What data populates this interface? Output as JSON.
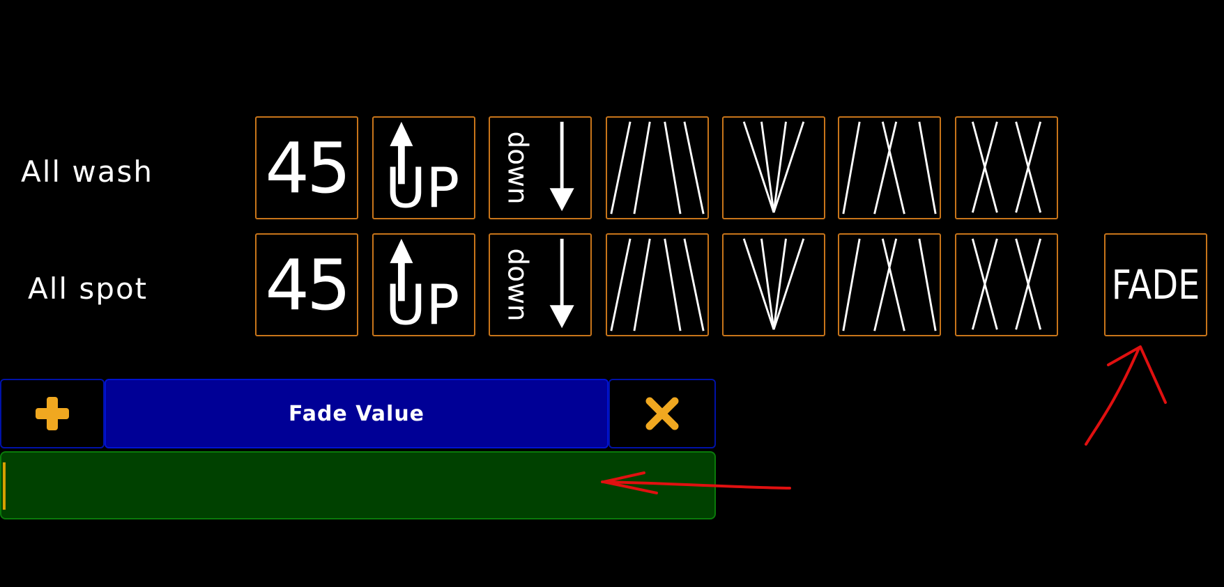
{
  "rows": [
    {
      "label": "All wash"
    },
    {
      "label": "All spot"
    }
  ],
  "buttons": {
    "degree_label": "45",
    "up_label": "UP",
    "down_label": "down",
    "fade_label": "FADE"
  },
  "dialog": {
    "title": "Fade Value",
    "input_value": ""
  },
  "icons": {
    "add": "plus-icon",
    "close": "close-icon"
  },
  "colors": {
    "button_border": "#c8751a",
    "title_bar": "#000096",
    "input_bg": "#004100",
    "accent": "#f0a820",
    "annotation": "#e01010"
  }
}
